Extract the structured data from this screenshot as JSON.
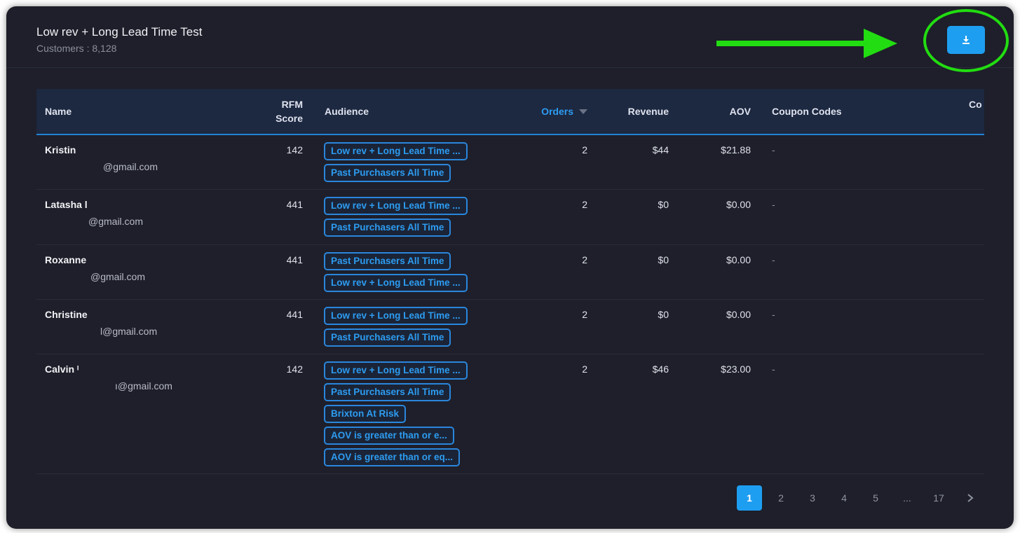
{
  "header": {
    "title": "Low rev + Long Lead Time Test",
    "subtitle": "Customers : 8,128"
  },
  "colors": {
    "accent": "#1e9ef0",
    "highlight": "#22dd11",
    "panel": "#1e1f2a"
  },
  "download_icon": "download-icon",
  "columns": {
    "name": "Name",
    "rfm_line1": "RFM",
    "rfm_line2": "Score",
    "audience": "Audience",
    "orders": "Orders",
    "revenue": "Revenue",
    "aov": "AOV",
    "coupon": "Coupon Codes",
    "cut": "Co"
  },
  "rows": [
    {
      "name": "Kristin",
      "email": "@gmail.com",
      "rfm": "142",
      "orders": "2",
      "revenue": "$44",
      "aov": "$21.88",
      "coupon": "-",
      "tags": [
        "Low rev + Long Lead Time ...",
        "Past Purchasers All Time"
      ]
    },
    {
      "name": "Latasha l",
      "email": "@gmail.com",
      "rfm": "441",
      "orders": "2",
      "revenue": "$0",
      "aov": "$0.00",
      "coupon": "-",
      "tags": [
        "Low rev + Long Lead Time ...",
        "Past Purchasers All Time"
      ]
    },
    {
      "name": "Roxanne",
      "email": "@gmail.com",
      "rfm": "441",
      "orders": "2",
      "revenue": "$0",
      "aov": "$0.00",
      "coupon": "-",
      "tags": [
        "Past Purchasers All Time",
        "Low rev + Long Lead Time ..."
      ]
    },
    {
      "name": "Christine",
      "email": "l@gmail.com",
      "rfm": "441",
      "orders": "2",
      "revenue": "$0",
      "aov": "$0.00",
      "coupon": "-",
      "tags": [
        "Low rev + Long Lead Time ...",
        "Past Purchasers All Time"
      ]
    },
    {
      "name": "Calvin ᴵ",
      "email": "ı@gmail.com",
      "rfm": "142",
      "orders": "2",
      "revenue": "$46",
      "aov": "$23.00",
      "coupon": "-",
      "tags": [
        "Low rev + Long Lead Time ...",
        "Past Purchasers All Time",
        "Brixton At Risk",
        "AOV is greater than or e...",
        "AOV is greater than or eq..."
      ]
    }
  ],
  "pagination": {
    "pages": [
      "1",
      "2",
      "3",
      "4",
      "5",
      "...",
      "17"
    ],
    "current": "1",
    "next_icon": "chevron-right-icon"
  }
}
